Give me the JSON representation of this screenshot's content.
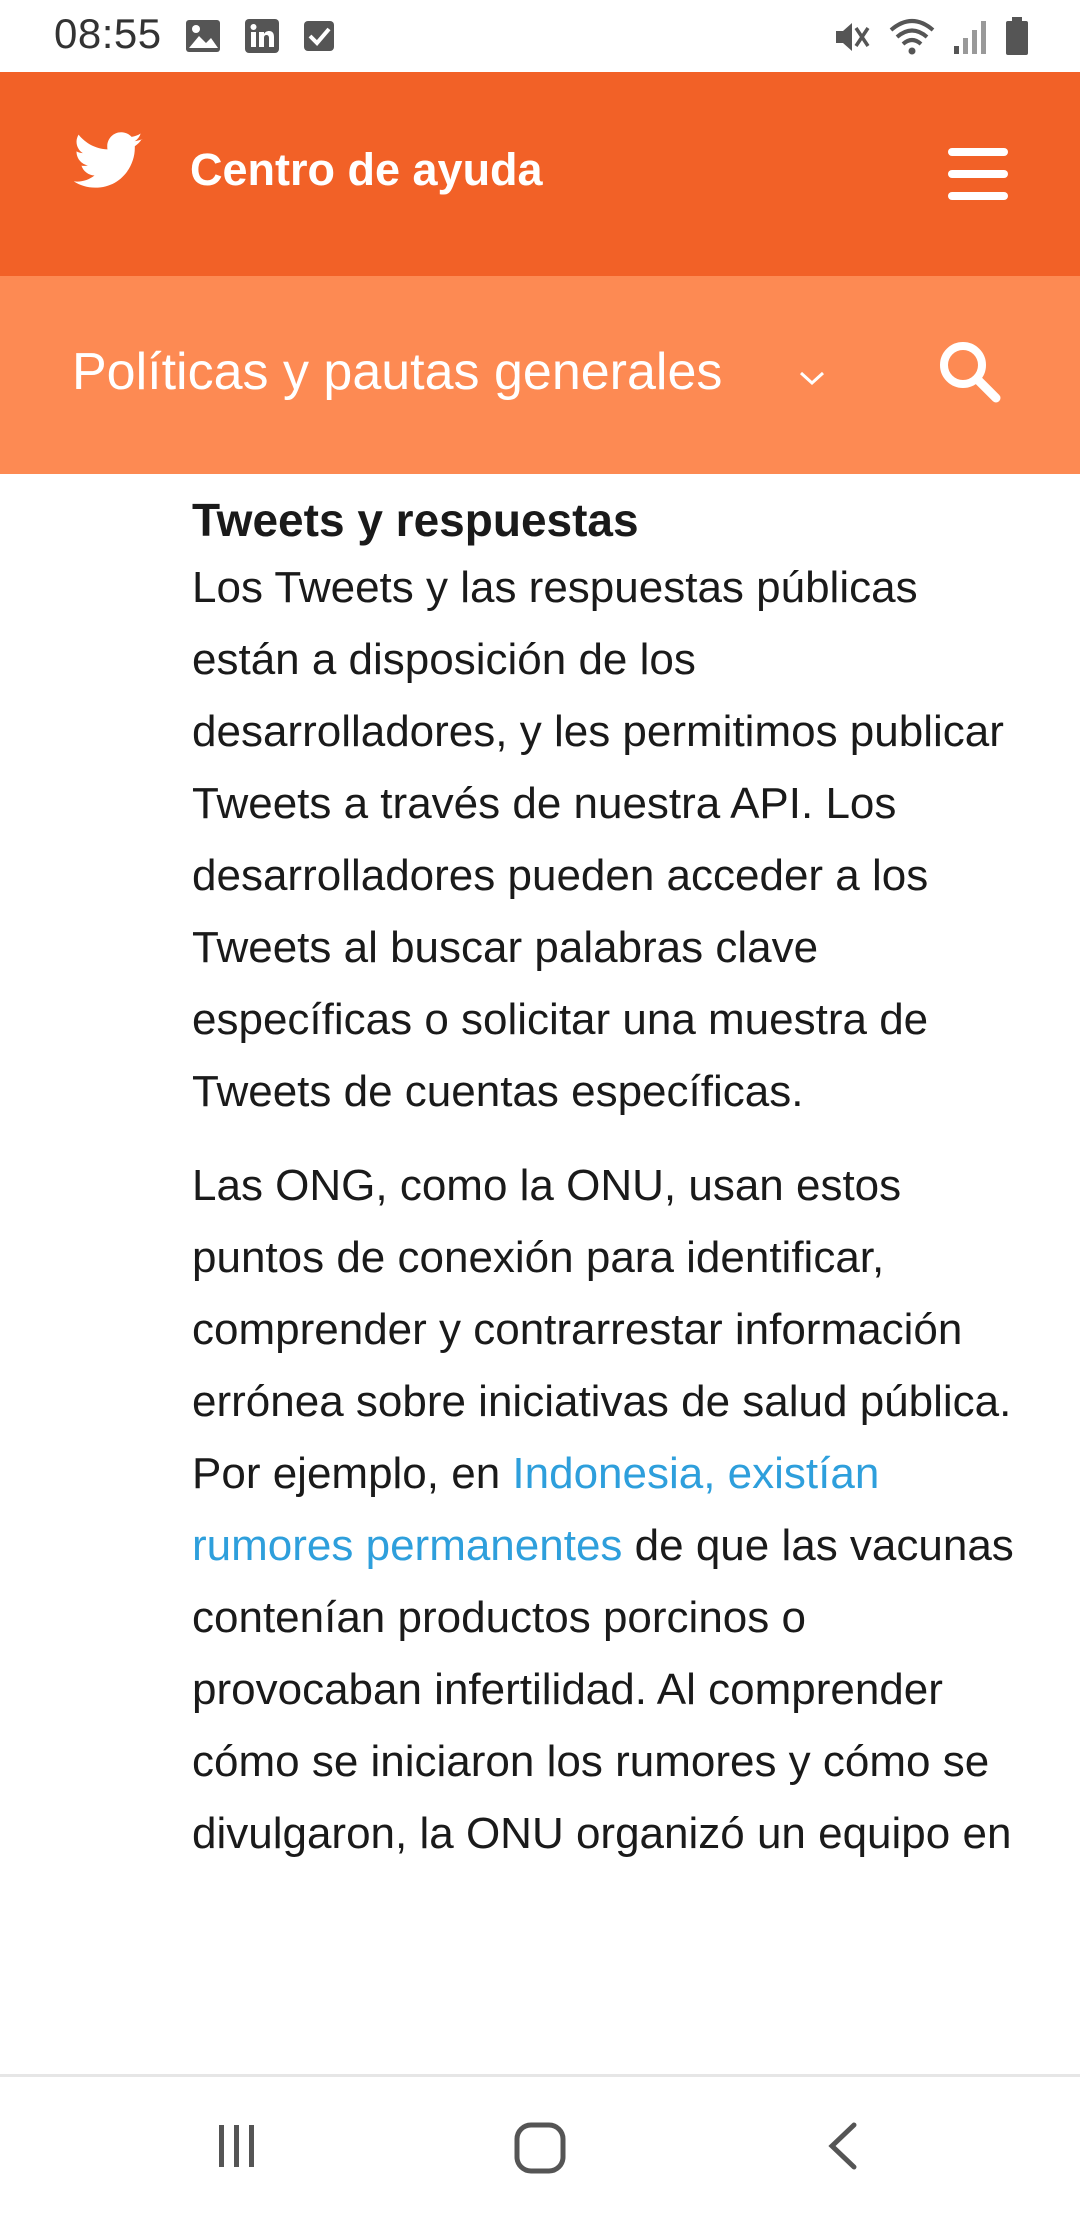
{
  "status_bar": {
    "time": "08:55",
    "left_icons": [
      "image-icon",
      "linkedin-icon",
      "checkbox-icon"
    ],
    "right_icons": [
      "mute-icon",
      "wifi-icon",
      "signal-icon",
      "battery-icon"
    ]
  },
  "header": {
    "title": "Centro de ayuda",
    "background": "#f26127"
  },
  "subheader": {
    "title": "Políticas y pautas generales",
    "background": "#fd8a53"
  },
  "article": {
    "section_title": "Tweets y respuestas",
    "paragraph1": "Los Tweets y las respuestas públicas están a disposición de los desarrolladores, y les permitimos publicar Tweets a través de nuestra API. Los desarrolladores pueden acceder a los Tweets al buscar palabras clave específicas o solicitar una muestra de Tweets de cuentas específicas.",
    "paragraph2_before_link": "Las ONG, como la ONU, usan estos puntos de conexión para identificar, comprender y contrarrestar información errónea sobre iniciativas de salud pública. Por ejemplo, en ",
    "paragraph2_link": "Indonesia, existían rumores permanentes",
    "paragraph2_after_link": " de que las vacunas contenían productos porcinos o provocaban infertilidad. Al comprender cómo se iniciaron los rumores y cómo se divulgaron, la ONU organizó un equipo en",
    "link_color": "#2e9fdc"
  },
  "nav_bar": {
    "buttons": [
      "recent-apps-icon",
      "home-icon",
      "back-icon"
    ]
  }
}
